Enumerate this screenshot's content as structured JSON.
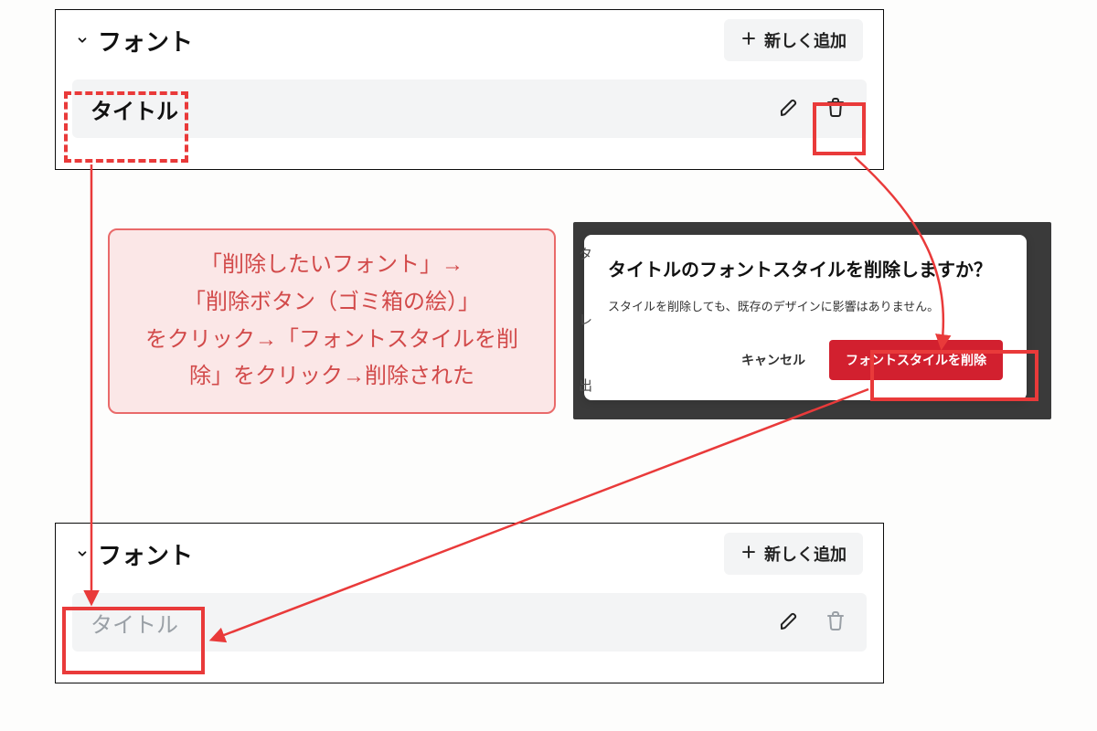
{
  "panel_top": {
    "title": "フォント",
    "add_label": "新しく追加",
    "row_title": "タイトル"
  },
  "panel_bottom": {
    "title": "フォント",
    "add_label": "新しく追加",
    "row_title": "タイトル"
  },
  "callout": {
    "text": "「削除したいフォント」→\n「削除ボタン（ゴミ箱の絵）」\nをクリック→「フォントスタイルを削\n除」をクリック→削除された"
  },
  "dialog": {
    "title": "タイトルのフォントスタイルを削除しますか？",
    "desc": "スタイルを削除しても、既存のデザインに影響はありません。",
    "cancel": "キャンセル",
    "confirm": "フォントスタイルを削除",
    "bg_glyphs": [
      "タ",
      "レ",
      "出"
    ]
  },
  "colors": {
    "annotation_red": "#e93a3a",
    "danger": "#d2202f",
    "callout_bg": "#fbe7e7"
  }
}
